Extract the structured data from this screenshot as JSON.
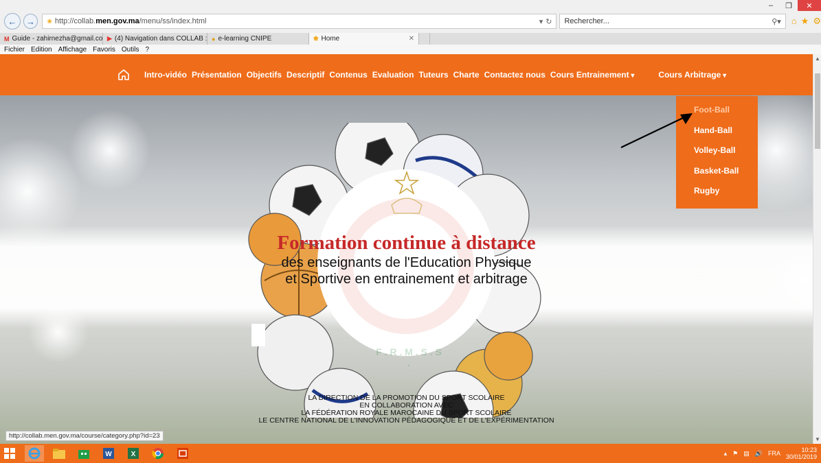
{
  "browser": {
    "url_prefix": "http://collab.",
    "url_host": "men.gov.ma",
    "url_path": "/menu/ss/index.html",
    "search_placeholder": "Rechercher...",
    "tabs": [
      {
        "icon": "M",
        "label": "Guide - zahirnezha@gmail.co..."
      },
      {
        "icon": "▶",
        "label": "(4) Navigation dans COLLAB : ..."
      },
      {
        "icon": "●",
        "label": "e-learning CNIPE"
      },
      {
        "icon": "❀",
        "label": "Home"
      }
    ],
    "menu": [
      "Fichier",
      "Edition",
      "Affichage",
      "Favoris",
      "Outils",
      "?"
    ],
    "status_url": "http://collab.men.gov.ma/course/category.php?id=23"
  },
  "site": {
    "nav": {
      "links": [
        "Intro-vidéo",
        "Présentation",
        "Objectifs",
        "Descriptif",
        "Contenus",
        "Evaluation",
        "Tuteurs",
        "Charte",
        "Contactez nous"
      ],
      "cours_entrainement": "Cours Entrainement",
      "cours_arbitrage": "Cours Arbitrage"
    },
    "dropdown": [
      "Foot-Ball",
      "Hand-Ball",
      "Volley-Ball",
      "Basket-Ball",
      "Rugby"
    ],
    "hero": {
      "title": "Formation continue à distance",
      "subtitle_1": "des enseignants de l'Education Physique",
      "subtitle_2": "et Sportive en entrainement et arbitrage",
      "emblem_text": "F . R . M . S . S ."
    },
    "credits": [
      "LA DIRECTION DE LA PROMOTION DU SPORT SCOLAIRE",
      "EN COLLABORATION AVEC",
      "LA FÉDÉRATION ROYALE MAROCAINE DU SPORT SCOLAIRE",
      "LE CENTRE NATIONAL DE L'INNOVATION PÉDAGOGIQUE ET DE L'EXPÉRIMENTATION"
    ]
  },
  "taskbar": {
    "lang": "FRA",
    "time": "10:23",
    "date": "30/01/2019"
  },
  "colors": {
    "accent": "#ef6c1a",
    "title_red": "#c62828"
  }
}
